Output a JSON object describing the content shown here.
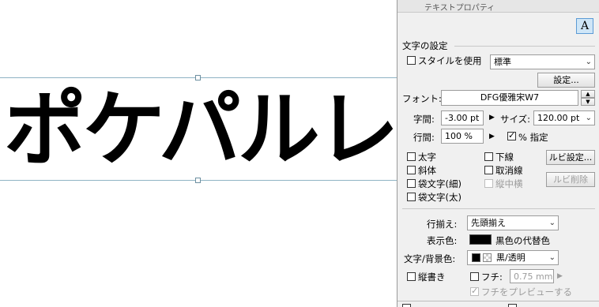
{
  "canvas": {
    "text": "ポケパルレ"
  },
  "panel": {
    "title": "テキストプロパティ",
    "corner_icon": "A",
    "section_char": "文字の設定",
    "use_style_label": "スタイルを使用",
    "style_value": "標準",
    "settings_button": "設定...",
    "font_label": "フォント:",
    "font_value": "DFG優雅宋W7",
    "tracking_label": "字間:",
    "tracking_value": "-3.00 pt",
    "size_label": "サイズ:",
    "size_value": "120.00 pt",
    "leading_label": "行間:",
    "leading_value": "100 %",
    "percent_spec_label": "% 指定",
    "bold_label": "太字",
    "underline_label": "下線",
    "ruby_settings_button": "ルビ設定...",
    "italic_label": "斜体",
    "strikethrough_label": "取消線",
    "outline_thin_label": "袋文字(細)",
    "tate_chu_yoko_label": "縦中横",
    "ruby_delete_button": "ルビ削除",
    "outline_thick_label": "袋文字(太)",
    "align_label": "行揃え:",
    "align_value": "先頭揃え",
    "display_color_label": "表示色:",
    "display_color_value": "黒色の代替色",
    "text_bg_color_label": "文字/背景色:",
    "text_bg_color_value": "黒/透明",
    "vertical_label": "縦書き",
    "border_label": "フチ:",
    "border_value": "0.75 mm",
    "preview_border_label": "フチをプレビューする"
  },
  "colors": {
    "guide": "#8fb3c4",
    "panel_bg": "#f0f0f0",
    "swatch": "#000000"
  }
}
